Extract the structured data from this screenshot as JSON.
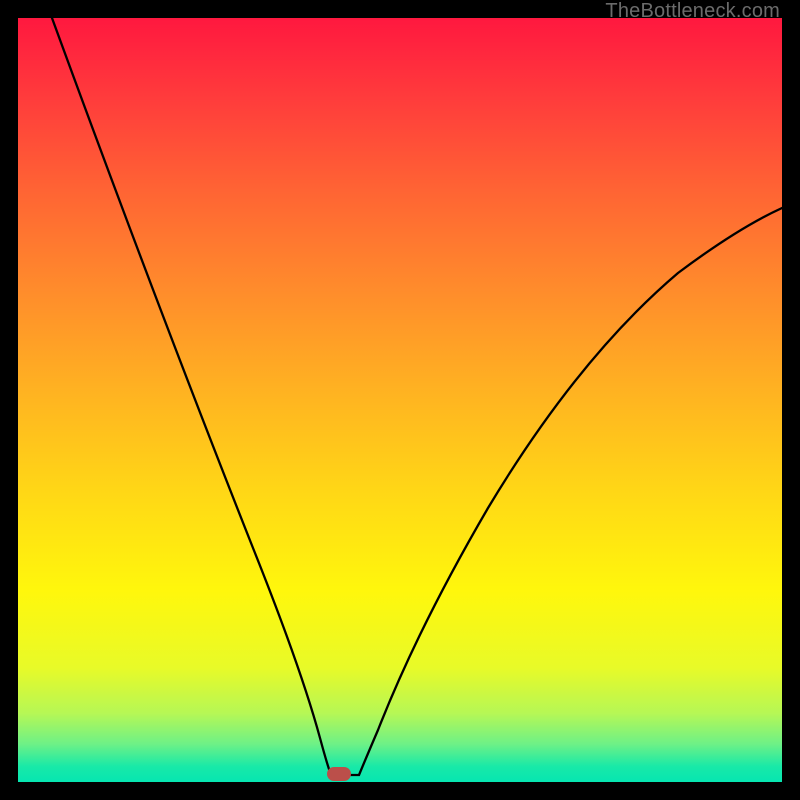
{
  "watermark": "TheBottleneck.com",
  "colors": {
    "frame": "#000000",
    "gradient_top": "#ff183f",
    "gradient_bottom": "#06e6b1",
    "curve": "#000000",
    "marker": "#bb4f4a"
  },
  "chart_data": {
    "type": "line",
    "title": "",
    "xlabel": "",
    "ylabel": "",
    "xlim": [
      0,
      100
    ],
    "ylim": [
      0,
      100
    ],
    "annotations": [
      {
        "kind": "marker",
        "x": 42,
        "y": 1,
        "color": "#bb4f4a"
      }
    ],
    "series": [
      {
        "name": "bottleneck-curve",
        "x": [
          0,
          5,
          10,
          15,
          20,
          25,
          30,
          35,
          38,
          40,
          42,
          44,
          46,
          50,
          55,
          60,
          65,
          70,
          75,
          80,
          85,
          90,
          95,
          100
        ],
        "values": [
          100,
          88,
          76,
          65,
          54,
          43,
          32,
          20,
          12,
          6,
          1,
          1,
          4,
          12,
          22,
          31,
          40,
          48,
          55,
          61,
          66,
          70,
          73,
          75
        ]
      }
    ]
  }
}
